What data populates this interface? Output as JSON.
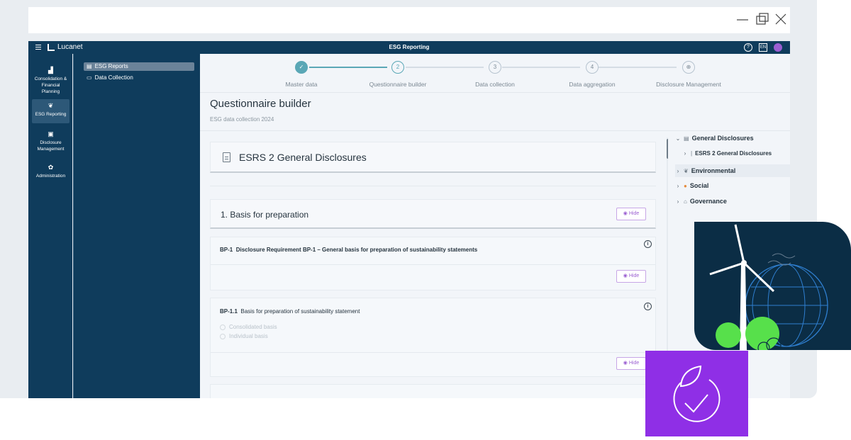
{
  "app": {
    "brand": "Lucanet",
    "title": "ESG Reporting",
    "lang_badge": "EN",
    "colors": {
      "navy": "#0f3c5c",
      "teal": "#5aa7b6",
      "purple": "#8f2fe6"
    }
  },
  "rail": {
    "items": [
      {
        "label": "Consolidation & Financial Planning",
        "icon": "chart-icon"
      },
      {
        "label": "ESG Reporting",
        "icon": "leaf-icon"
      },
      {
        "label": "Disclosure Management",
        "icon": "document-icon"
      },
      {
        "label": "Administration",
        "icon": "gear-icon"
      }
    ]
  },
  "tree": {
    "items": [
      {
        "label": "ESG Reports",
        "icon": "file-icon"
      },
      {
        "label": "Data Collection",
        "icon": "folder-icon"
      }
    ]
  },
  "stepper": {
    "steps": [
      {
        "num": "✓",
        "label": "Master data"
      },
      {
        "num": "2",
        "label": "Questionnaire builder"
      },
      {
        "num": "3",
        "label": "Data collection"
      },
      {
        "num": "4",
        "label": "Data aggregation"
      },
      {
        "num": "⊕",
        "label": "Disclosure Management"
      }
    ]
  },
  "page": {
    "title": "Questionnaire builder",
    "subtitle": "ESG data collection 2024"
  },
  "main": {
    "doc_title": "ESRS 2 General Disclosures",
    "section_title": "1. Basis for preparation",
    "hide_label": "Hide",
    "bp1": {
      "code": "BP-1",
      "text": "Disclosure Requirement BP-1 – General basis for preparation of sustainability statements"
    },
    "bp11": {
      "code": "BP-1.1",
      "text": "Basis for preparation of sustainability statement"
    },
    "options": [
      "Consolidated basis",
      "Individual basis"
    ]
  },
  "right_tree": {
    "general": "General Disclosures",
    "esrs2": "ESRS 2 General Disclosures",
    "environmental": "Environmental",
    "social": "Social",
    "governance": "Governance"
  }
}
